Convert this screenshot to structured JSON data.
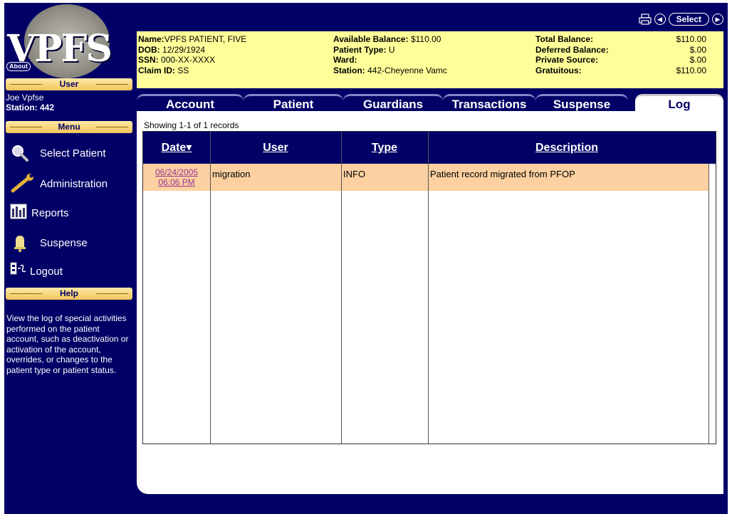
{
  "app": {
    "logo_text": "VPFS",
    "about_label": "About",
    "select_label": "Select"
  },
  "sidebar": {
    "user_header": "User",
    "user_name": "Joe Vpfse",
    "user_station": "Station: 442",
    "menu_header": "Menu",
    "menu_items": [
      {
        "label": "Select Patient",
        "icon": "magnifier-icon"
      },
      {
        "label": "Administration",
        "icon": "wrench-icon"
      },
      {
        "label": "Reports",
        "icon": "reports-icon"
      },
      {
        "label": "Suspense",
        "icon": "bell-icon"
      },
      {
        "label": "Logout",
        "icon": "logout-icon"
      }
    ],
    "help_header": "Help",
    "help_text": "View the log of special activities performed on the patient account, such as deactivation or activation of the account, overrides, or changes to the patient type or patient status."
  },
  "patient": {
    "name_label": "Name:",
    "name": "VPFS PATIENT, FIVE",
    "dob_label": "DOB:",
    "dob": "12/29/1924",
    "ssn_label": "SSN:",
    "ssn": "000-XX-XXXX",
    "claim_label": "Claim ID:",
    "claim": "SS",
    "available_label": "Available Balance:",
    "available": "$110.00",
    "type_label": "Patient Type:",
    "type": "U",
    "ward_label": "Ward:",
    "ward": "",
    "station_label": "Station:",
    "station": "442-Cheyenne Vamc",
    "total_label": "Total Balance:",
    "total": "$110.00",
    "deferred_label": "Deferred Balance:",
    "deferred": "$.00",
    "private_label": "Private Source:",
    "private": "$.00",
    "gratuitous_label": "Gratuitous:",
    "gratuitous": "$110.00"
  },
  "tabs": [
    {
      "label": "Account",
      "active": false
    },
    {
      "label": "Patient",
      "active": false
    },
    {
      "label": "Guardians",
      "active": false
    },
    {
      "label": "Transactions",
      "active": false
    },
    {
      "label": "Suspense",
      "active": false
    },
    {
      "label": "Log",
      "active": true
    }
  ],
  "log": {
    "records_text": "Showing 1-1 of 1 records",
    "columns": [
      "Date",
      "User",
      "Type",
      "Description"
    ],
    "sort_indicator": "▾",
    "rows": [
      {
        "date": "06/24/2005",
        "time": "06:06 PM",
        "user": "migration",
        "type": "INFO",
        "description": "Patient record migrated from PFOP"
      }
    ]
  },
  "colors": {
    "navy": "#000066",
    "header_yellow": "#ffff99",
    "row_highlight": "#fcd0a0",
    "section_gold": "#f2c45a",
    "link_purple": "#993399"
  }
}
